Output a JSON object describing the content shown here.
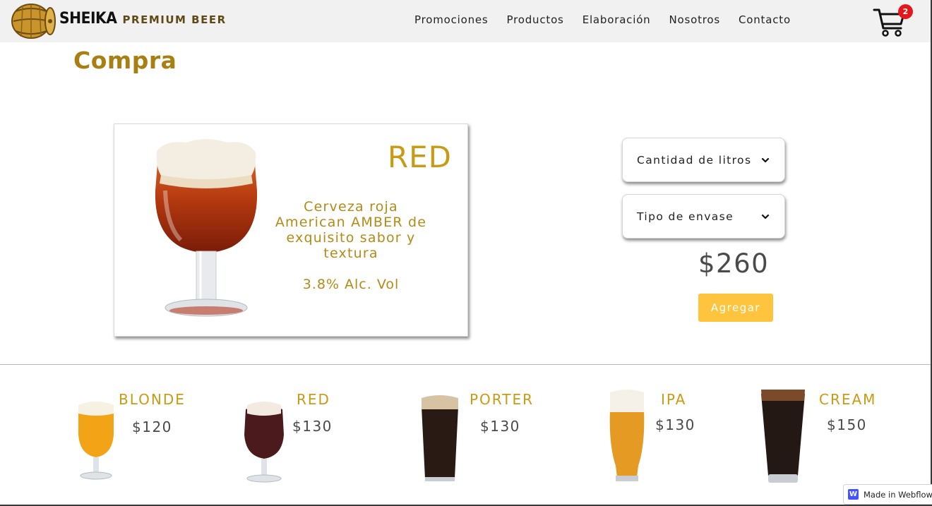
{
  "brand": {
    "name": "SHEIKA",
    "tagline": "PREMIUM BEER"
  },
  "nav": {
    "links": [
      "Promociones",
      "Productos",
      "Elaboración",
      "Nosotros",
      "Contacto"
    ],
    "cart_count": "2"
  },
  "page": {
    "title": "Compra"
  },
  "featured": {
    "name": "RED",
    "description": "Cerveza roja American AMBER de exquisito sabor y textura",
    "alcohol": "3.8% Alc. Vol",
    "beer_color": "#b3380f"
  },
  "order": {
    "liters_label": "Cantidad de litros",
    "container_label": "Tipo de envase",
    "price": "$260",
    "add_label": "Agregar"
  },
  "products": [
    {
      "name": "BLONDE",
      "price": "$120",
      "beer_color": "#f2a416"
    },
    {
      "name": "RED",
      "price": "$130",
      "beer_color": "#4a1a1c"
    },
    {
      "name": "PORTER",
      "price": "$130",
      "beer_color": "#2a1a14"
    },
    {
      "name": "IPA",
      "price": "$130",
      "beer_color": "#e49a23"
    },
    {
      "name": "CREAM",
      "price": "$150",
      "beer_color": "#231814"
    }
  ],
  "badge": {
    "label": "Made in Webflow"
  },
  "colors": {
    "accent_gold": "#c89b14",
    "title_gold": "#a87f12",
    "button": "#ffc43d",
    "badge_red": "#e4171d"
  }
}
